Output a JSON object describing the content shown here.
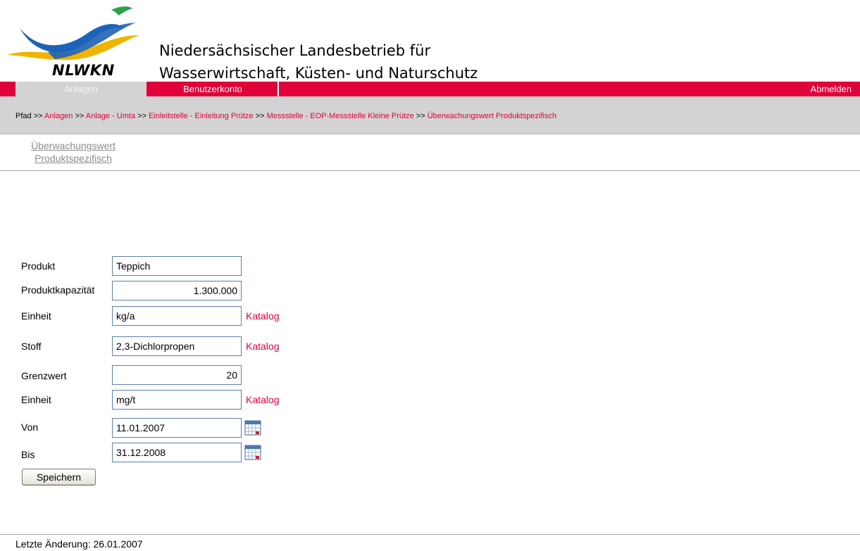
{
  "header": {
    "logo_text": "NLWKN",
    "title_line1": "Niedersächsischer Landesbetrieb für",
    "title_line2": "Wasserwirtschaft, Küsten- und Naturschutz"
  },
  "menu": {
    "anlagen": "Anlagen",
    "benutzerkonto": "Benutzerkonto",
    "abmelden": "Abmelden"
  },
  "breadcrumb": {
    "prefix": "Pfad",
    "separator": ">>",
    "items": [
      "Anlagen",
      "Anlage - Umta",
      "Einleitstelle - Einleitung Prütze",
      "Messstelle - EOP-Messstelle Kleine Prütze",
      "Überwachungswert Produktspezifisch"
    ]
  },
  "subnav": {
    "line1": "Überwachungswert",
    "line2": "Produktspezifisch"
  },
  "form": {
    "produkt_label": "Produkt",
    "produkt_value": "Teppich",
    "kapazitaet_label": "Produktkapazität",
    "kapazitaet_value": "1.300.000",
    "einheit1_label": "Einheit",
    "einheit1_value": "kg/a",
    "stoff_label": "Stoff",
    "stoff_value": "2,3-Dichlorpropen",
    "grenzwert_label": "Grenzwert",
    "grenzwert_value": "20",
    "einheit2_label": "Einheit",
    "einheit2_value": "mg/t",
    "von_label": "Von",
    "von_value": "11.01.2007",
    "bis_label": "Bis",
    "bis_value": "31.12.2008",
    "katalog_label": "Katalog",
    "save_label": "Speichern"
  },
  "footer": {
    "last_change": "Letzte Änderung: 26.01.2007"
  },
  "colors": {
    "accent": "#e0003a",
    "grey_bar": "#d3d3d3",
    "input_border": "#5c7fb0"
  },
  "icons": {
    "calendar": "calendar-icon",
    "logo": "nlwkn-logo"
  }
}
